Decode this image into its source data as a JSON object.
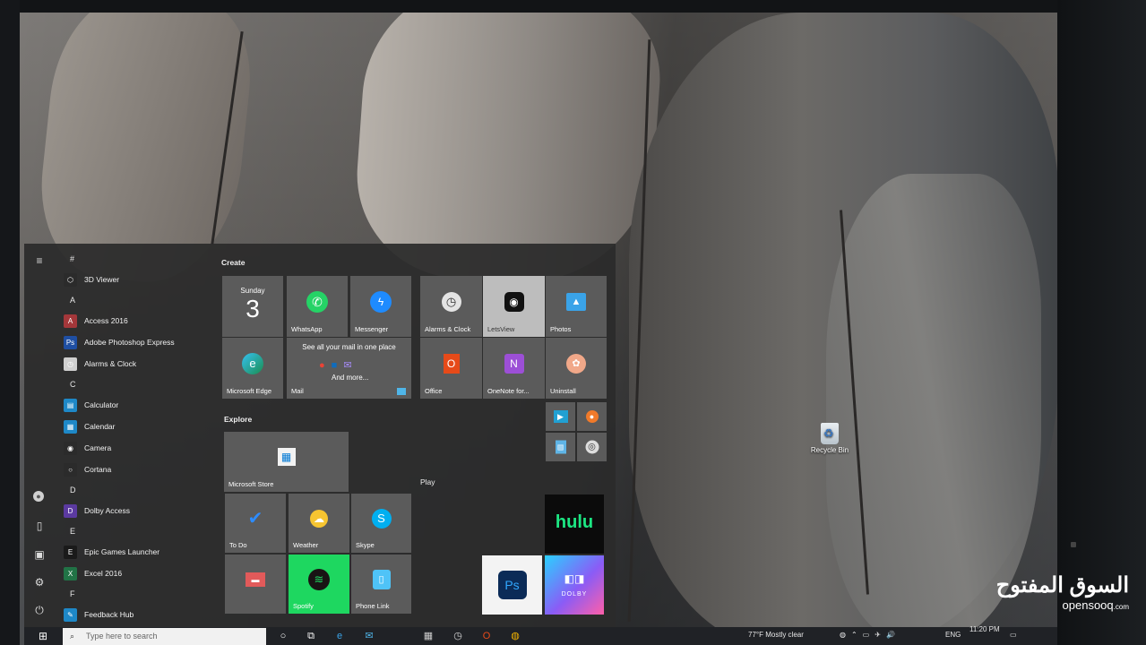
{
  "start_menu": {
    "rail": {
      "icons": [
        "hamburger-icon",
        "user-icon",
        "document-icon",
        "pictures-icon",
        "settings-icon",
        "power-icon"
      ]
    },
    "app_list": [
      {
        "type": "letter",
        "text": "#"
      },
      {
        "type": "app",
        "label": "3D Viewer",
        "icon": "cube-icon",
        "color": "#2b2b2b"
      },
      {
        "type": "letter",
        "text": "A"
      },
      {
        "type": "app",
        "label": "Access 2016",
        "icon": "access-icon",
        "color": "#a4373a"
      },
      {
        "type": "app",
        "label": "Adobe Photoshop Express",
        "icon": "photoshop-express-icon",
        "color": "#1f4fa3"
      },
      {
        "type": "app",
        "label": "Alarms & Clock",
        "icon": "clock-icon",
        "color": "#cfcfcf"
      },
      {
        "type": "letter",
        "text": "C"
      },
      {
        "type": "app",
        "label": "Calculator",
        "icon": "calculator-icon",
        "color": "#1e88c7"
      },
      {
        "type": "app",
        "label": "Calendar",
        "icon": "calendar-icon",
        "color": "#1e88c7"
      },
      {
        "type": "app",
        "label": "Camera",
        "icon": "camera-icon",
        "color": "#2b2b2b"
      },
      {
        "type": "app",
        "label": "Cortana",
        "icon": "cortana-icon",
        "color": "#2b2b2b"
      },
      {
        "type": "letter",
        "text": "D"
      },
      {
        "type": "app",
        "label": "Dolby Access",
        "icon": "dolby-icon",
        "color": "#5b3aa0"
      },
      {
        "type": "letter",
        "text": "E"
      },
      {
        "type": "app",
        "label": "Epic Games Launcher",
        "icon": "epic-games-icon",
        "color": "#1a1a1a"
      },
      {
        "type": "app",
        "label": "Excel 2016",
        "icon": "excel-icon",
        "color": "#217346"
      },
      {
        "type": "letter",
        "text": "F"
      },
      {
        "type": "app",
        "label": "Feedback Hub",
        "icon": "feedback-icon",
        "color": "#1e88c7"
      }
    ],
    "groups": {
      "create": "Create",
      "explore": "Explore",
      "play": "Play"
    },
    "tiles": {
      "calendar": {
        "day": "Sunday",
        "date": "3"
      },
      "whatsapp": "WhatsApp",
      "messenger": "Messenger",
      "alarms": "Alarms & Clock",
      "letsview": "LetsView",
      "photos": "Photos",
      "edge": "Microsoft Edge",
      "mail": {
        "label": "Mail",
        "headline": "See all your mail in one place",
        "more": "And more..."
      },
      "office": "Office",
      "onenote": "OneNote for...",
      "uninstall": "Uninstall",
      "store": "Microsoft Store",
      "todo": "To Do",
      "weather": "Weather",
      "skype": "Skype",
      "spotify": "Spotify",
      "phonelink": "Phone Link",
      "hulu": "hulu",
      "dolby": "DOLBY"
    }
  },
  "desktop": {
    "recycle_bin": "Recycle Bin"
  },
  "taskbar": {
    "search_placeholder": "Type here to search",
    "weather": "77°F  Mostly clear",
    "language": "ENG",
    "time": "11:20 PM"
  },
  "watermark": {
    "arabic": "السوق المفتوح",
    "latin": "opensooq",
    "suffix": ".com"
  }
}
